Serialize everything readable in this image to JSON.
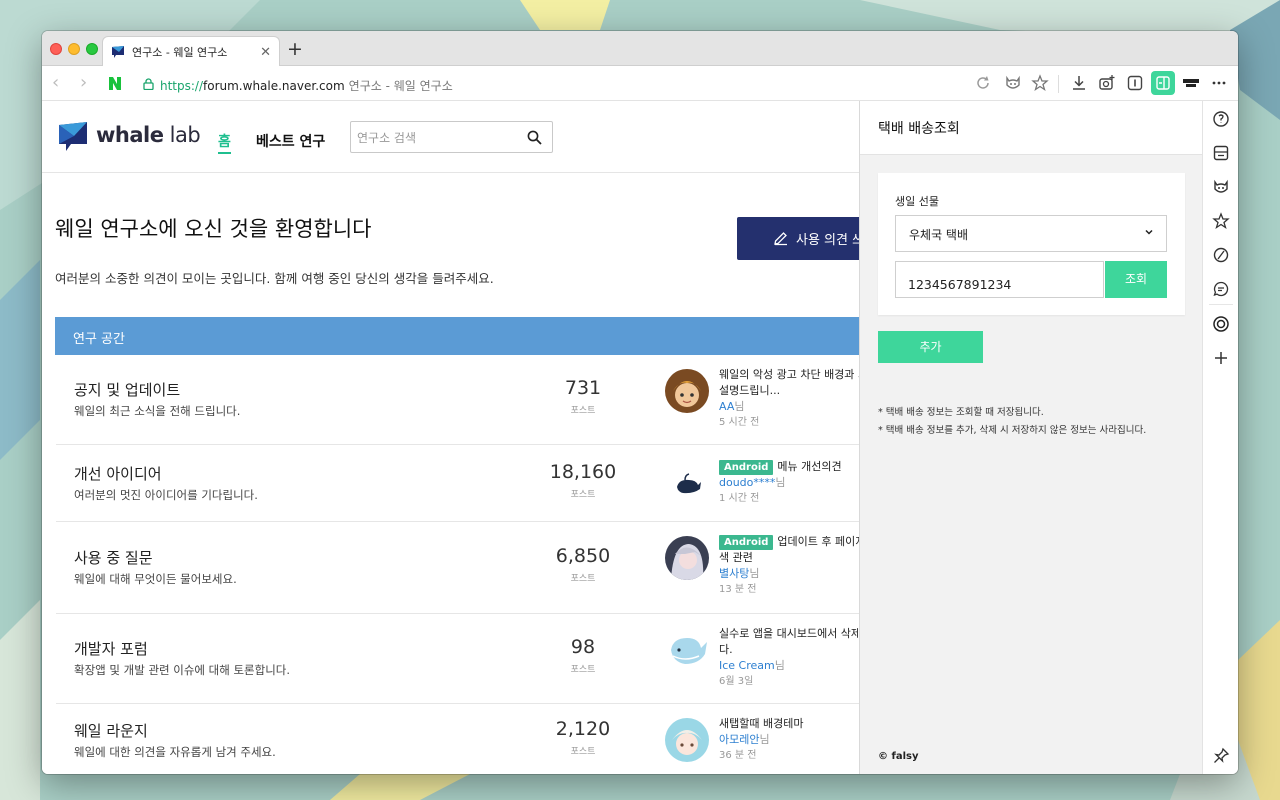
{
  "browser": {
    "tab_title": "연구소 - 웨일 연구소",
    "new_tab": "+",
    "url_scheme": "https://",
    "url_host": "forum.whale.naver.com",
    "page_title": "연구소 - 웨일 연구소"
  },
  "site": {
    "logo_word1": "whale",
    "logo_word2": " lab",
    "nav": {
      "home": "홈",
      "best": "베스트 연구"
    },
    "search_placeholder": "연구소 검색"
  },
  "hero": {
    "title": "웨일 연구소에 오신 것을 환영합니다",
    "subtitle": "여러분의 소중한 의견이 모이는 곳입니다. 함께 여행 중인 당신의 생각을 들려주세요.",
    "feedback_button": "사용 의견 쓰"
  },
  "section": {
    "title": "연구 공간"
  },
  "forums": [
    {
      "title": "공지 및 업데이트",
      "desc": "웨일의 최근 소식을 전해 드립니다.",
      "count": "731",
      "count_label": "포스트",
      "post_line1": "웨일의 악성 광고 차단 배경과 기",
      "post_line2": "설명드립니...",
      "author": "AA",
      "suffix": "님",
      "time": "5 시간 전"
    },
    {
      "title": "개선 아이디어",
      "desc": "여러분의 멋진 아이디어를 기다립니다.",
      "count": "18,160",
      "count_label": "포스트",
      "tag": "Android",
      "post_line1": "메뉴 개선의견",
      "author": "doudo****",
      "suffix": "님",
      "time": "1 시간 전"
    },
    {
      "title": "사용 중 질문",
      "desc": "웨일에 대해 무엇이든 물어보세요.",
      "count": "6,850",
      "count_label": "포스트",
      "tag": "Android",
      "post_line1": "업데이트 후 페이지",
      "post_line2": "색 관련",
      "author": "별사탕",
      "suffix": "님",
      "time": "13 분 전"
    },
    {
      "title": "개발자 포럼",
      "desc": "확장앱 및 개발 관련 이슈에 대해 토론합니다.",
      "count": "98",
      "count_label": "포스트",
      "post_line1": "실수로 앱을 대시보드에서 삭제",
      "post_line2": "다.",
      "author": "Ice Cream",
      "suffix": "님",
      "time": "6월 3일"
    },
    {
      "title": "웨일 라운지",
      "desc": "웨일에 대한 의견을 자유롭게 남겨 주세요.",
      "count": "2,120",
      "count_label": "포스트",
      "post_line1": "새탭할때 배경테마",
      "author": "아모레안",
      "suffix": "님",
      "time": "36 분 전"
    }
  ],
  "sidepanel": {
    "title": "택배 배송조회",
    "label": "생일 선물",
    "carrier_selected": "우체국 택배",
    "tracking_number": "1234567891234",
    "query_button": "조회",
    "add_button": "추가",
    "note1": "* 택배 배송 정보는 조회할 때 저장됩니다.",
    "note2": "* 택배 배송 정보를 추가, 삭제 시 저장하지 않은 정보는 사라집니다.",
    "footer": "© falsy"
  },
  "colors": {
    "accent_green": "#3ed69b",
    "home_green": "#1fbf8f",
    "section_blue": "#5b9bd5",
    "feedback_navy": "#24306e",
    "tag_green": "#3bb88f",
    "author_blue": "#2d7fd0"
  },
  "icons": {
    "toolbar": [
      "reload-icon",
      "whale-mascot-icon",
      "bookmark-star-icon",
      "download-icon",
      "capture-icon",
      "sidebar-toggle-icon",
      "extension-panel-icon",
      "falsy-lab-icon",
      "more-icon"
    ],
    "dock": [
      "papago-icon",
      "calculator-icon",
      "whale-mascot-icon",
      "bookmark-star-icon",
      "music-icon",
      "chat-icon",
      "target-icon",
      "add-icon",
      "pin-icon"
    ]
  }
}
